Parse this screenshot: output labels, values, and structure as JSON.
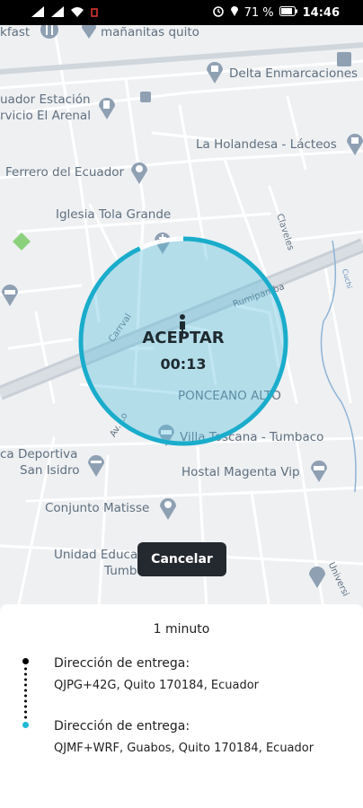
{
  "status_bar": {
    "battery": "71 %",
    "time": "14:46"
  },
  "map": {
    "labels": {
      "kfast": "kfast",
      "mananitas": "mañanitas quito",
      "delta": "Delta Enmarcaciones",
      "estacion1": "uador Estación",
      "estacion2": "rvicio El Arenal",
      "holandesa": "La Holandesa - Lácteos",
      "ferrero": "Ferrero del Ecuador",
      "iglesia": "Iglesia Tola Grande",
      "claveles": "Claveles",
      "rumipamba": "Rumipamba",
      "carrval": "Carrval",
      "cuchi": "Cuchi",
      "ponceano": "PONCEANO ALTO",
      "av": "Av. Lo",
      "villa": "Villa Toscana - Tumbaco",
      "deportiva": "ca Deportiva",
      "sanisidro": "San Isidro",
      "hostal": "Hostal Magenta Vip",
      "matisse": "Conjunto Matisse",
      "unidad1": "Unidad Educa",
      "unidad2": "Tumba",
      "universi": "Universi"
    },
    "icons": [
      "fork-knife-icon",
      "shopping-bag-icon",
      "fuel-icon",
      "bus-stop-icon",
      "place-pin-icon",
      "church-pin-icon",
      "bed-icon",
      "dumbbell-icon"
    ]
  },
  "accept_button": {
    "label": "ACEPTAR",
    "timer": "00:13",
    "progress": 0.93,
    "color": "#1aaccb"
  },
  "cancel_button": {
    "label": "Cancelar"
  },
  "trip": {
    "duration": "1 minuto",
    "pickup": {
      "title": "Dirección de entrega:",
      "address": "QJPG+42G, Quito 170184, Ecuador"
    },
    "dropoff": {
      "title": "Dirección de entrega:",
      "address": "QJMF+WRF, Guabos, Quito 170184, Ecuador"
    }
  }
}
